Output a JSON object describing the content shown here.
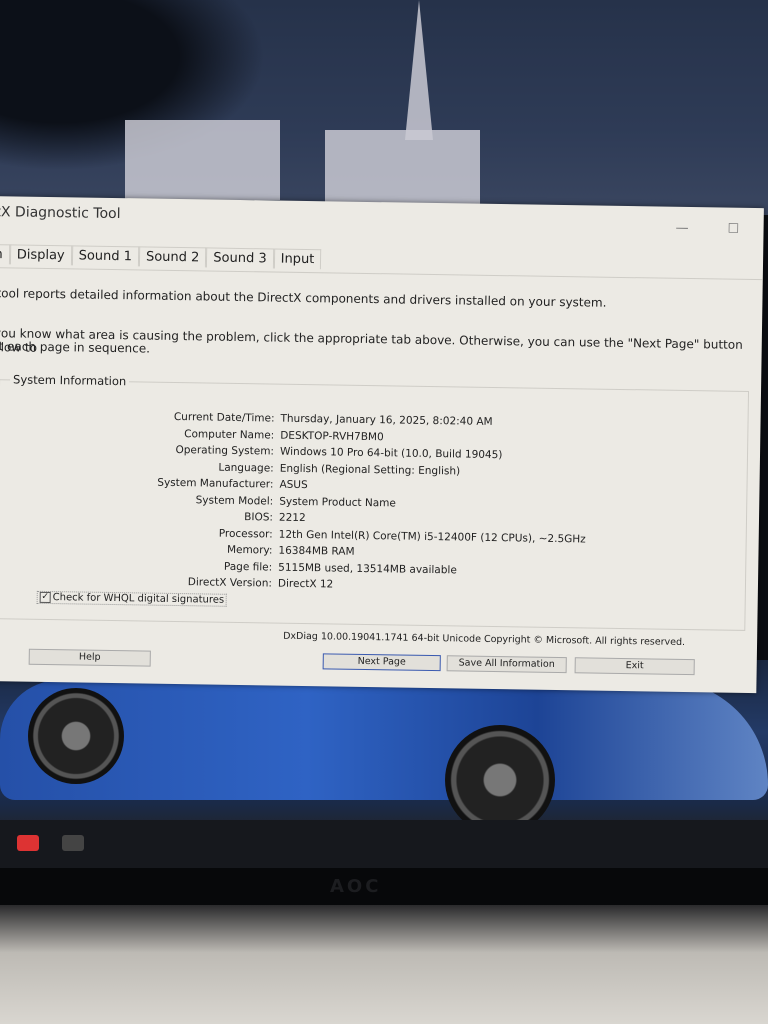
{
  "window": {
    "title": "ctX Diagnostic Tool",
    "minimize_icon": "minimize-icon",
    "maximize_icon": "maximize-icon"
  },
  "tabs": [
    {
      "label": "m"
    },
    {
      "label": "Display"
    },
    {
      "label": "Sound 1"
    },
    {
      "label": "Sound 2"
    },
    {
      "label": "Sound 3"
    },
    {
      "label": "Input"
    }
  ],
  "intro": {
    "line1": "s tool reports detailed information about the DirectX components and drivers installed on your system.",
    "line2": "f you know what area is causing the problem, click the appropriate tab above.  Otherwise, you can use the \"Next Page\" button below to",
    "line3": "isit each page in sequence."
  },
  "system_information": {
    "heading": "System Information",
    "rows": [
      {
        "label": "Current Date/Time:",
        "value": "Thursday, January 16, 2025, 8:02:40 AM"
      },
      {
        "label": "Computer Name:",
        "value": "DESKTOP-RVH7BM0"
      },
      {
        "label": "Operating System:",
        "value": "Windows 10 Pro 64-bit (10.0, Build 19045)"
      },
      {
        "label": "Language:",
        "value": "English (Regional Setting: English)"
      },
      {
        "label": "System Manufacturer:",
        "value": "ASUS"
      },
      {
        "label": "System Model:",
        "value": "System Product Name"
      },
      {
        "label": "BIOS:",
        "value": "2212"
      },
      {
        "label": "Processor:",
        "value": "12th Gen Intel(R) Core(TM) i5-12400F (12 CPUs), ~2.5GHz"
      },
      {
        "label": "Memory:",
        "value": "16384MB RAM"
      },
      {
        "label": "Page file:",
        "value": "5115MB used, 13514MB available"
      },
      {
        "label": "DirectX Version:",
        "value": "DirectX 12"
      }
    ],
    "whql_checkbox": {
      "label": "Check for WHQL digital signatures",
      "checked": true
    }
  },
  "footer": {
    "copyright": "DxDiag 10.00.19041.1741 64-bit Unicode  Copyright © Microsoft. All rights reserved.",
    "help": "Help",
    "next_page": "Next Page",
    "save_all": "Save All Information",
    "exit": "Exit"
  },
  "monitor": {
    "brand": "AOC"
  }
}
